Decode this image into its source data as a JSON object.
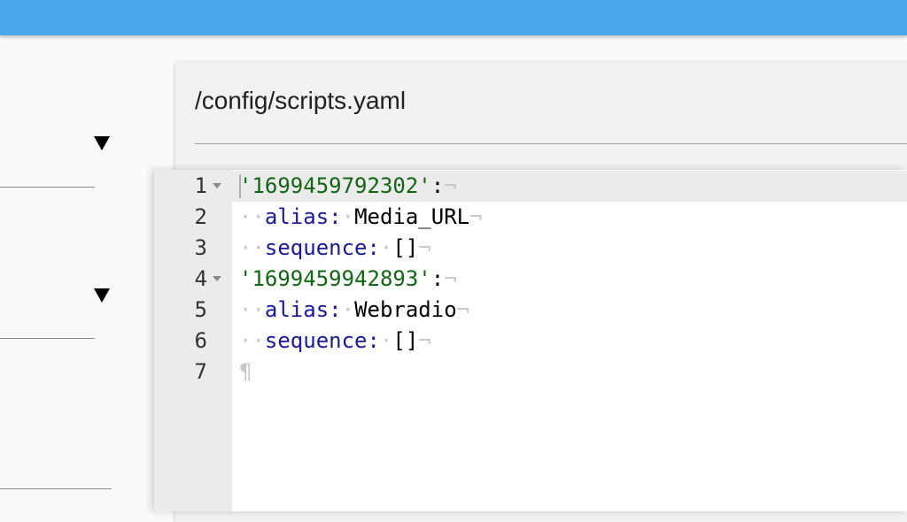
{
  "header": {
    "bar_color": "#4aa6ea"
  },
  "card": {
    "title": "/config/scripts.yaml"
  },
  "editor": {
    "lines": [
      {
        "number": "1",
        "foldable": true,
        "active": true,
        "tokens": [
          {
            "t": "'1699459792302'",
            "c": "str"
          },
          {
            "t": ":",
            "c": "pun"
          },
          {
            "t": "¬",
            "c": "ws"
          }
        ]
      },
      {
        "number": "2",
        "foldable": false,
        "active": false,
        "tokens": [
          {
            "t": "··",
            "c": "ws"
          },
          {
            "t": "alias",
            "c": "key"
          },
          {
            "t": ":",
            "c": "key"
          },
          {
            "t": "·",
            "c": "ws"
          },
          {
            "t": "Media_URL",
            "c": "val"
          },
          {
            "t": "¬",
            "c": "ws"
          }
        ]
      },
      {
        "number": "3",
        "foldable": false,
        "active": false,
        "tokens": [
          {
            "t": "··",
            "c": "ws"
          },
          {
            "t": "sequence",
            "c": "key"
          },
          {
            "t": ":",
            "c": "key"
          },
          {
            "t": "·",
            "c": "ws"
          },
          {
            "t": "[]",
            "c": "val"
          },
          {
            "t": "¬",
            "c": "ws"
          }
        ]
      },
      {
        "number": "4",
        "foldable": true,
        "active": false,
        "tokens": [
          {
            "t": "'1699459942893'",
            "c": "str"
          },
          {
            "t": ":",
            "c": "pun"
          },
          {
            "t": "¬",
            "c": "ws"
          }
        ]
      },
      {
        "number": "5",
        "foldable": false,
        "active": false,
        "tokens": [
          {
            "t": "··",
            "c": "ws"
          },
          {
            "t": "alias",
            "c": "key"
          },
          {
            "t": ":",
            "c": "key"
          },
          {
            "t": "·",
            "c": "ws"
          },
          {
            "t": "Webradio",
            "c": "val"
          },
          {
            "t": "¬",
            "c": "ws"
          }
        ]
      },
      {
        "number": "6",
        "foldable": false,
        "active": false,
        "tokens": [
          {
            "t": "··",
            "c": "ws"
          },
          {
            "t": "sequence",
            "c": "key"
          },
          {
            "t": ":",
            "c": "key"
          },
          {
            "t": "·",
            "c": "ws"
          },
          {
            "t": "[]",
            "c": "val"
          },
          {
            "t": "¬",
            "c": "ws"
          }
        ]
      },
      {
        "number": "7",
        "foldable": false,
        "active": false,
        "tokens": [
          {
            "t": "¶",
            "c": "ws"
          }
        ]
      }
    ]
  }
}
